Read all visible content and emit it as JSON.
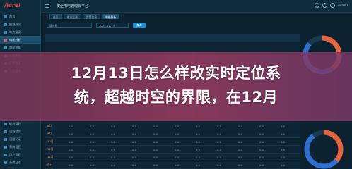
{
  "app": {
    "logo": "Acrel",
    "platform_title": "安全用电管理云平台",
    "user": "admin"
  },
  "sidebar": {
    "items": [
      {
        "label": "首页"
      },
      {
        "label": "配电概况"
      },
      {
        "label": "电力监测"
      },
      {
        "label": "电能分析",
        "active": true
      },
      {
        "label": "电能质量"
      },
      {
        "label": "安全用电"
      },
      {
        "label": "告警信息"
      },
      {
        "label": "运维管理"
      }
    ],
    "bottom_items": [
      {
        "label": "能耗管理"
      },
      {
        "label": "设备档案"
      },
      {
        "label": "运维记录"
      },
      {
        "label": "系统设置"
      },
      {
        "label": "用户管理"
      },
      {
        "label": "系统日志"
      }
    ]
  },
  "tabs": [
    {
      "label": "首页"
    },
    {
      "label": "电力监测"
    },
    {
      "label": "告警信息"
    },
    {
      "label": "电能分析",
      "active": true
    }
  ],
  "filters": {
    "station": "请选择",
    "date": "2024-12-13",
    "query_label": "查询"
  },
  "table": {
    "rows": [
      [
        "8月",
        "0.0",
        "0.0",
        "0.0",
        "0.0",
        "0.0",
        "0.0",
        "0.0",
        "0.0",
        "0.0",
        "0.0",
        "0.0"
      ],
      [
        "9月",
        "0.0",
        "0.0",
        "0.0",
        "0.0",
        "0.0",
        "0.0",
        "0.0",
        "0.0",
        "0.0",
        "0.0",
        "0.0"
      ],
      [
        "10月",
        "0.0",
        "0.0",
        "0.0",
        "0.0",
        "0.0",
        "0.0",
        "0.0",
        "0.0",
        "0.0",
        "0.0",
        "0.0"
      ],
      [
        "11月",
        "0.0",
        "0.0",
        "0.0",
        "0.0",
        "0.0",
        "0.0",
        "0.0",
        "0.0",
        "0.0",
        "0.0",
        "0.0"
      ],
      [
        "12月",
        "0.0",
        "0.0",
        "0.0",
        "0.0",
        "0.0",
        "0.0",
        "0.0",
        "0.0",
        "0.0",
        "0.0",
        "0.0"
      ],
      [
        "合计",
        "0.0",
        "0.0",
        "0.0",
        "0.0",
        "0.0",
        "0.0",
        "0.0",
        "0.0",
        "0.0",
        "0.0",
        "0.0"
      ]
    ]
  },
  "colors": {
    "accent": "#1f8ed0",
    "donut_orange": "#e8623a",
    "donut_blue": "#2f6fd0",
    "band": "#9c3c60"
  },
  "headline": {
    "line1": "12月13日怎么样改实时定位系",
    "line2": "统，超越时空的界限，在12月"
  }
}
